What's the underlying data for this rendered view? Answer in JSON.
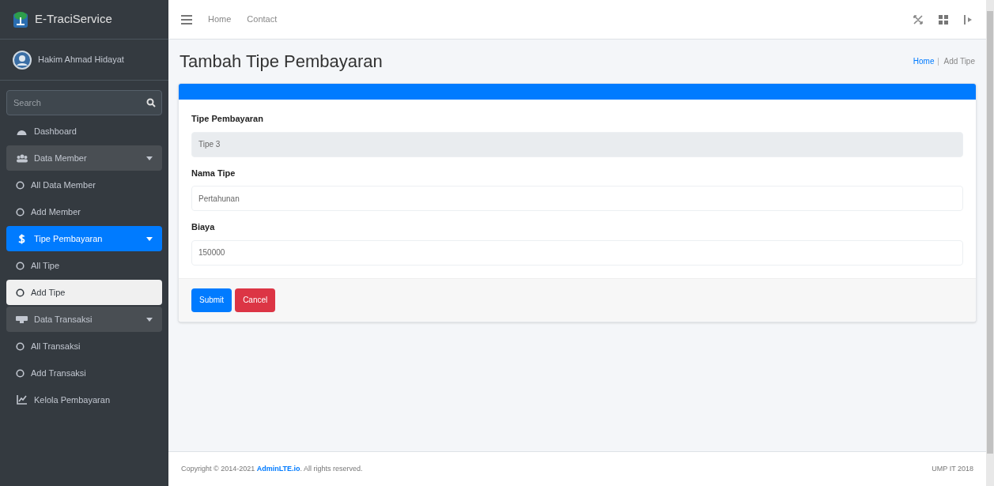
{
  "brand": {
    "title": "E-TraciService"
  },
  "user": {
    "name": "Hakim Ahmad Hidayat"
  },
  "sidebar_search": {
    "placeholder": "Search"
  },
  "sidebar": {
    "items": [
      {
        "kind": "link",
        "label": "Dashboard",
        "selected": false
      },
      {
        "kind": "group",
        "label": "Data Member",
        "selected": false,
        "expanded": true
      },
      {
        "kind": "sub",
        "label": "All Data Member",
        "selected": false
      },
      {
        "kind": "sub",
        "label": "Add Member",
        "selected": false
      },
      {
        "kind": "group",
        "label": "Tipe Pembayaran",
        "selected": true,
        "expanded": true
      },
      {
        "kind": "sub",
        "label": "All Tipe",
        "selected": false
      },
      {
        "kind": "sub",
        "label": "Add Tipe",
        "selected": true
      },
      {
        "kind": "group",
        "label": "Data Transaksi",
        "selected": false,
        "expanded": true
      },
      {
        "kind": "sub",
        "label": "All Transaksi",
        "selected": false
      },
      {
        "kind": "sub",
        "label": "Add Transaksi",
        "selected": false
      },
      {
        "kind": "link",
        "label": "Kelola Pembayaran",
        "selected": false
      }
    ]
  },
  "navbar": {
    "links": [
      "Home",
      "Contact"
    ]
  },
  "page": {
    "title": "Tambah Tipe Pembayaran",
    "breadcrumb": [
      "Home",
      "Add Tipe"
    ]
  },
  "form": {
    "fields": [
      {
        "label": "Tipe Pembayaran",
        "value": "Tipe 3",
        "disabled": true
      },
      {
        "label": "Nama Tipe",
        "value": "Pertahunan",
        "disabled": false
      },
      {
        "label": "Biaya",
        "value": "150000",
        "disabled": false
      }
    ],
    "buttons": [
      {
        "label": "Submit",
        "kind": "primary"
      },
      {
        "label": "Cancel",
        "kind": "danger"
      }
    ]
  },
  "footer": {
    "copyright": "Copyright © 2014-2021 **AdminLTE.io**. All rights reserved.",
    "version": "UMP IT 2018"
  }
}
